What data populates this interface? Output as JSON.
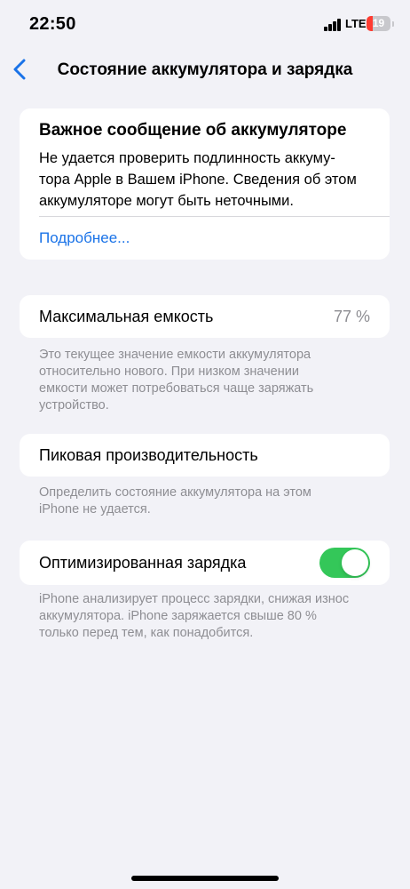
{
  "status_bar": {
    "time": "22:50",
    "network": "LTE",
    "battery_level": "19"
  },
  "nav": {
    "title": "Состояние аккумулятора и зарядка"
  },
  "notice": {
    "title": "Важное сообщение об аккумуляторе",
    "lines": [
      "Не удается проверить подлинность аккуму-",
      "тора Apple в Вашем iPhone. Сведения об этом",
      "аккумуляторе могут быть неточными."
    ],
    "link": "Подробнее..."
  },
  "max_capacity": {
    "label": "Максимальная емкость",
    "value": "77 %",
    "footnote_lines": [
      "Это текущее значение емкости аккумулятора",
      "относительно нового. При низком значении",
      "емкости может потребоваться чаще заряжать",
      "устройство."
    ]
  },
  "peak_performance": {
    "label": "Пиковая производительность",
    "footnote_lines": [
      "Определить состояние аккумулятора на этом",
      "iPhone не удается."
    ]
  },
  "optimized_charging": {
    "label": "Оптимизированная зарядка",
    "enabled": true,
    "footnote_lines": [
      "iPhone анализирует процесс зарядки, снижая износ",
      "аккумулятора. iPhone заряжается свыше 80 %",
      "только перед тем, как понадобится."
    ]
  },
  "colors": {
    "accent": "#1a73e8",
    "toggle_on": "#34c759",
    "battery_low": "#ff3b30",
    "background": "#f2f2f7"
  }
}
